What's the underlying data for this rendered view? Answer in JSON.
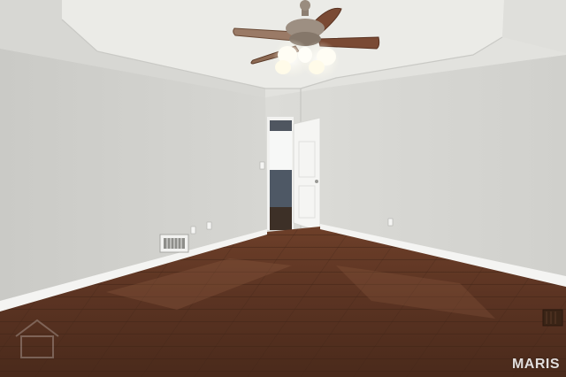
{
  "photo": {
    "watermark_text": "MARIS",
    "colors": {
      "wall_left": "#d3d3cf",
      "wall_right": "#d9d9d5",
      "ceiling": "#e4e4e0",
      "floor": "#5a3322",
      "floor_light": "#7a4a30",
      "baseboard": "#f4f4f2",
      "fan_blade": "#7a4a34",
      "fan_metal": "#8d7f72",
      "light_glow": "#fffbe9"
    },
    "icons": [
      "ceiling-fan-icon",
      "air-vent-icon",
      "door-icon",
      "outlet-icon",
      "logo-watermark-icon"
    ]
  }
}
